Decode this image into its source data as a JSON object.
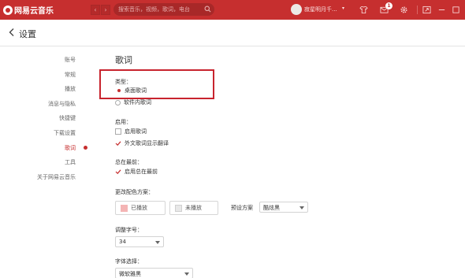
{
  "app": {
    "logo_text": "网易云音乐"
  },
  "topbar": {
    "search_placeholder": "搜索音乐，视频，歌词，电台",
    "username": "寂星明月千...",
    "caret": "▾",
    "message_badge": "1",
    "back_glyph": "‹",
    "forward_glyph": "›"
  },
  "header": {
    "title": "设置"
  },
  "sidebar": {
    "items": [
      {
        "label": "账号"
      },
      {
        "label": "常规"
      },
      {
        "label": "播放"
      },
      {
        "label": "消息与隐私"
      },
      {
        "label": "快捷键"
      },
      {
        "label": "下载设置"
      },
      {
        "label": "歌词",
        "active": true
      },
      {
        "label": "工具"
      },
      {
        "label": "关于网易云音乐"
      }
    ]
  },
  "lyrics": {
    "title": "歌词",
    "type": {
      "label": "类型：",
      "options": [
        {
          "label": "桌面歌词",
          "selected": true
        },
        {
          "label": "软件内歌词",
          "selected": false
        }
      ]
    },
    "enable": {
      "label": "启用：",
      "options": [
        {
          "label": "启用歌词",
          "checked": false
        },
        {
          "label": "外文歌词显示翻译",
          "checked": true
        }
      ]
    },
    "always_on_top": {
      "label": "总在最前：",
      "options": [
        {
          "label": "启用总在最前",
          "checked": true
        }
      ]
    },
    "color_scheme": {
      "label": "更改配色方案：",
      "played_label": "已播放",
      "played_color": "#f4b4b4",
      "unplayed_label": "未播放",
      "unplayed_color": "#e8e8e8",
      "preset_label": "预设方案",
      "preset_value": "酷炫黑"
    },
    "font_size": {
      "label": "调整字号：",
      "value": "34"
    },
    "font_family": {
      "label": "字体选择：",
      "value": "微软雅黑"
    }
  },
  "colors": {
    "accent": "#c62f2f",
    "highlight_box": "#c8242e"
  }
}
